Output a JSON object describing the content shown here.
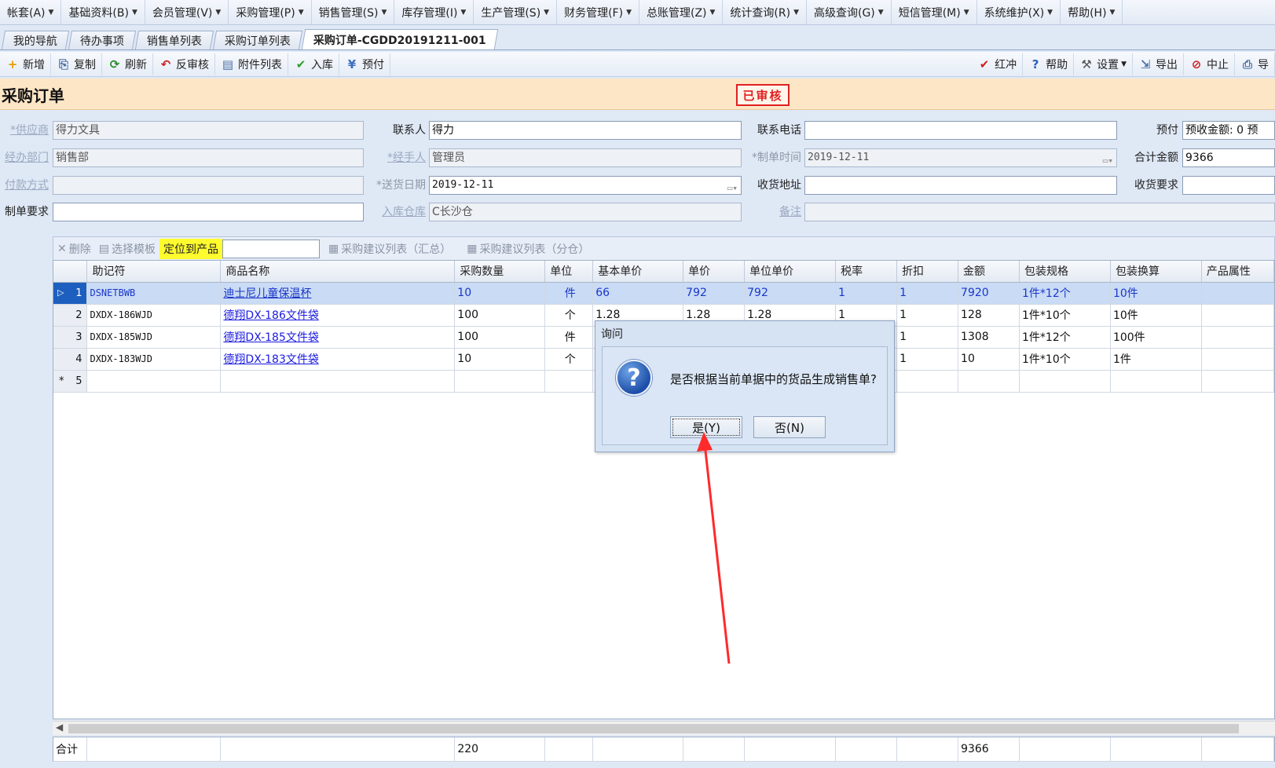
{
  "menu": [
    "帐套(A)",
    "基础资料(B)",
    "会员管理(V)",
    "采购管理(P)",
    "销售管理(S)",
    "库存管理(I)",
    "生产管理(S)",
    "财务管理(F)",
    "总账管理(Z)",
    "统计查询(R)",
    "高级查询(G)",
    "短信管理(M)",
    "系统维护(X)",
    "帮助(H)"
  ],
  "tabs": [
    "我的导航",
    "待办事项",
    "销售单列表",
    "采购订单列表",
    "采购订单-CGDD20191211-001"
  ],
  "toolbar": {
    "left": [
      {
        "label": "新增",
        "icon": "plus-icon"
      },
      {
        "label": "复制",
        "icon": "copy-icon"
      },
      {
        "label": "刷新",
        "icon": "refresh-icon"
      },
      {
        "label": "反审核",
        "icon": "undo-icon"
      },
      {
        "label": "附件列表",
        "icon": "attachment-icon"
      },
      {
        "label": "入库",
        "icon": "check-icon"
      },
      {
        "label": "预付",
        "icon": "prepay-icon"
      }
    ],
    "right": [
      {
        "label": "红冲",
        "icon": "red-check-icon"
      },
      {
        "label": "帮助",
        "icon": "help-icon"
      },
      {
        "label": "设置",
        "icon": "tools-icon"
      },
      {
        "label": "导出",
        "icon": "export-icon"
      },
      {
        "label": "中止",
        "icon": "stop-icon"
      },
      {
        "label": "导",
        "icon": "print-icon"
      }
    ]
  },
  "title": "采购订单",
  "status": "已审核",
  "form": {
    "supplier_label": "*供应商",
    "supplier": "得力文具",
    "contact_label": "联系人",
    "contact": "得力",
    "phone_label": "联系电话",
    "phone": "",
    "prepay_label": "预付",
    "prepay": "预收金额: 0  预",
    "dept_label": "经办部门",
    "dept": "销售部",
    "handler_label": "*经手人",
    "handler": "管理员",
    "created_label": "*制单时间",
    "created": "2019-12-11",
    "total_label": "合计金额",
    "total": "9366",
    "payment_label": "付款方式",
    "payment": "",
    "delivery_label": "*送货日期",
    "delivery": "2019-12-11",
    "address_label": "收货地址",
    "address": "",
    "req_label": "收货要求",
    "req": "",
    "order_req_label": "制单要求",
    "order_req": "",
    "warehouse_label": "入库仓库",
    "warehouse": "C长沙仓",
    "remark_label": "备注",
    "remark": ""
  },
  "grid_toolbar": {
    "delete": "删除",
    "template": "选择模板",
    "locate": "定位到产品",
    "suggest_sum": "采购建议列表（汇总）",
    "suggest_split": "采购建议列表（分仓）"
  },
  "columns": [
    "助记符",
    "商品名称",
    "采购数量",
    "单位",
    "基本单价",
    "单价",
    "单位单价",
    "税率",
    "折扣",
    "金额",
    "包装规格",
    "包装换算",
    "产品属性"
  ],
  "rows": [
    {
      "no": "1",
      "code": "DSNETBWB",
      "name": "迪士尼儿童保温杯",
      "qty": "10",
      "unit": "件",
      "base": "66",
      "price": "792",
      "uprice": "792",
      "tax": "1",
      "disc": "1",
      "amount": "7920",
      "spec": "1件*12个",
      "conv": "10件"
    },
    {
      "no": "2",
      "code": "DXDX-186WJD",
      "name": "德翔DX-186文件袋",
      "qty": "100",
      "unit": "个",
      "base": "1.28",
      "price": "1.28",
      "uprice": "1.28",
      "tax": "1",
      "disc": "1",
      "amount": "128",
      "spec": "1件*10个",
      "conv": "10件"
    },
    {
      "no": "3",
      "code": "DXDX-185WJD",
      "name": "德翔DX-185文件袋",
      "qty": "100",
      "unit": "件",
      "base": "",
      "price": "",
      "uprice": "",
      "tax": "",
      "disc": "1",
      "amount": "1308",
      "spec": "1件*12个",
      "conv": "100件"
    },
    {
      "no": "4",
      "code": "DXDX-183WJD",
      "name": "德翔DX-183文件袋",
      "qty": "10",
      "unit": "个",
      "base": "",
      "price": "",
      "uprice": "",
      "tax": "",
      "disc": "1",
      "amount": "10",
      "spec": "1件*10个",
      "conv": "1件"
    }
  ],
  "new_row_no": "5",
  "footer": {
    "label": "合计",
    "qty": "220",
    "amount": "9366"
  },
  "dialog": {
    "title": "询问",
    "message": "是否根据当前单据中的货品生成销售单?",
    "yes": "是(Y)",
    "no": "否(N)"
  },
  "colors": {
    "accent": "#1d5fbf",
    "status_red": "#e02020",
    "annotation_arrow": "#ff2a2a",
    "title_bg": "#fde6c6"
  }
}
